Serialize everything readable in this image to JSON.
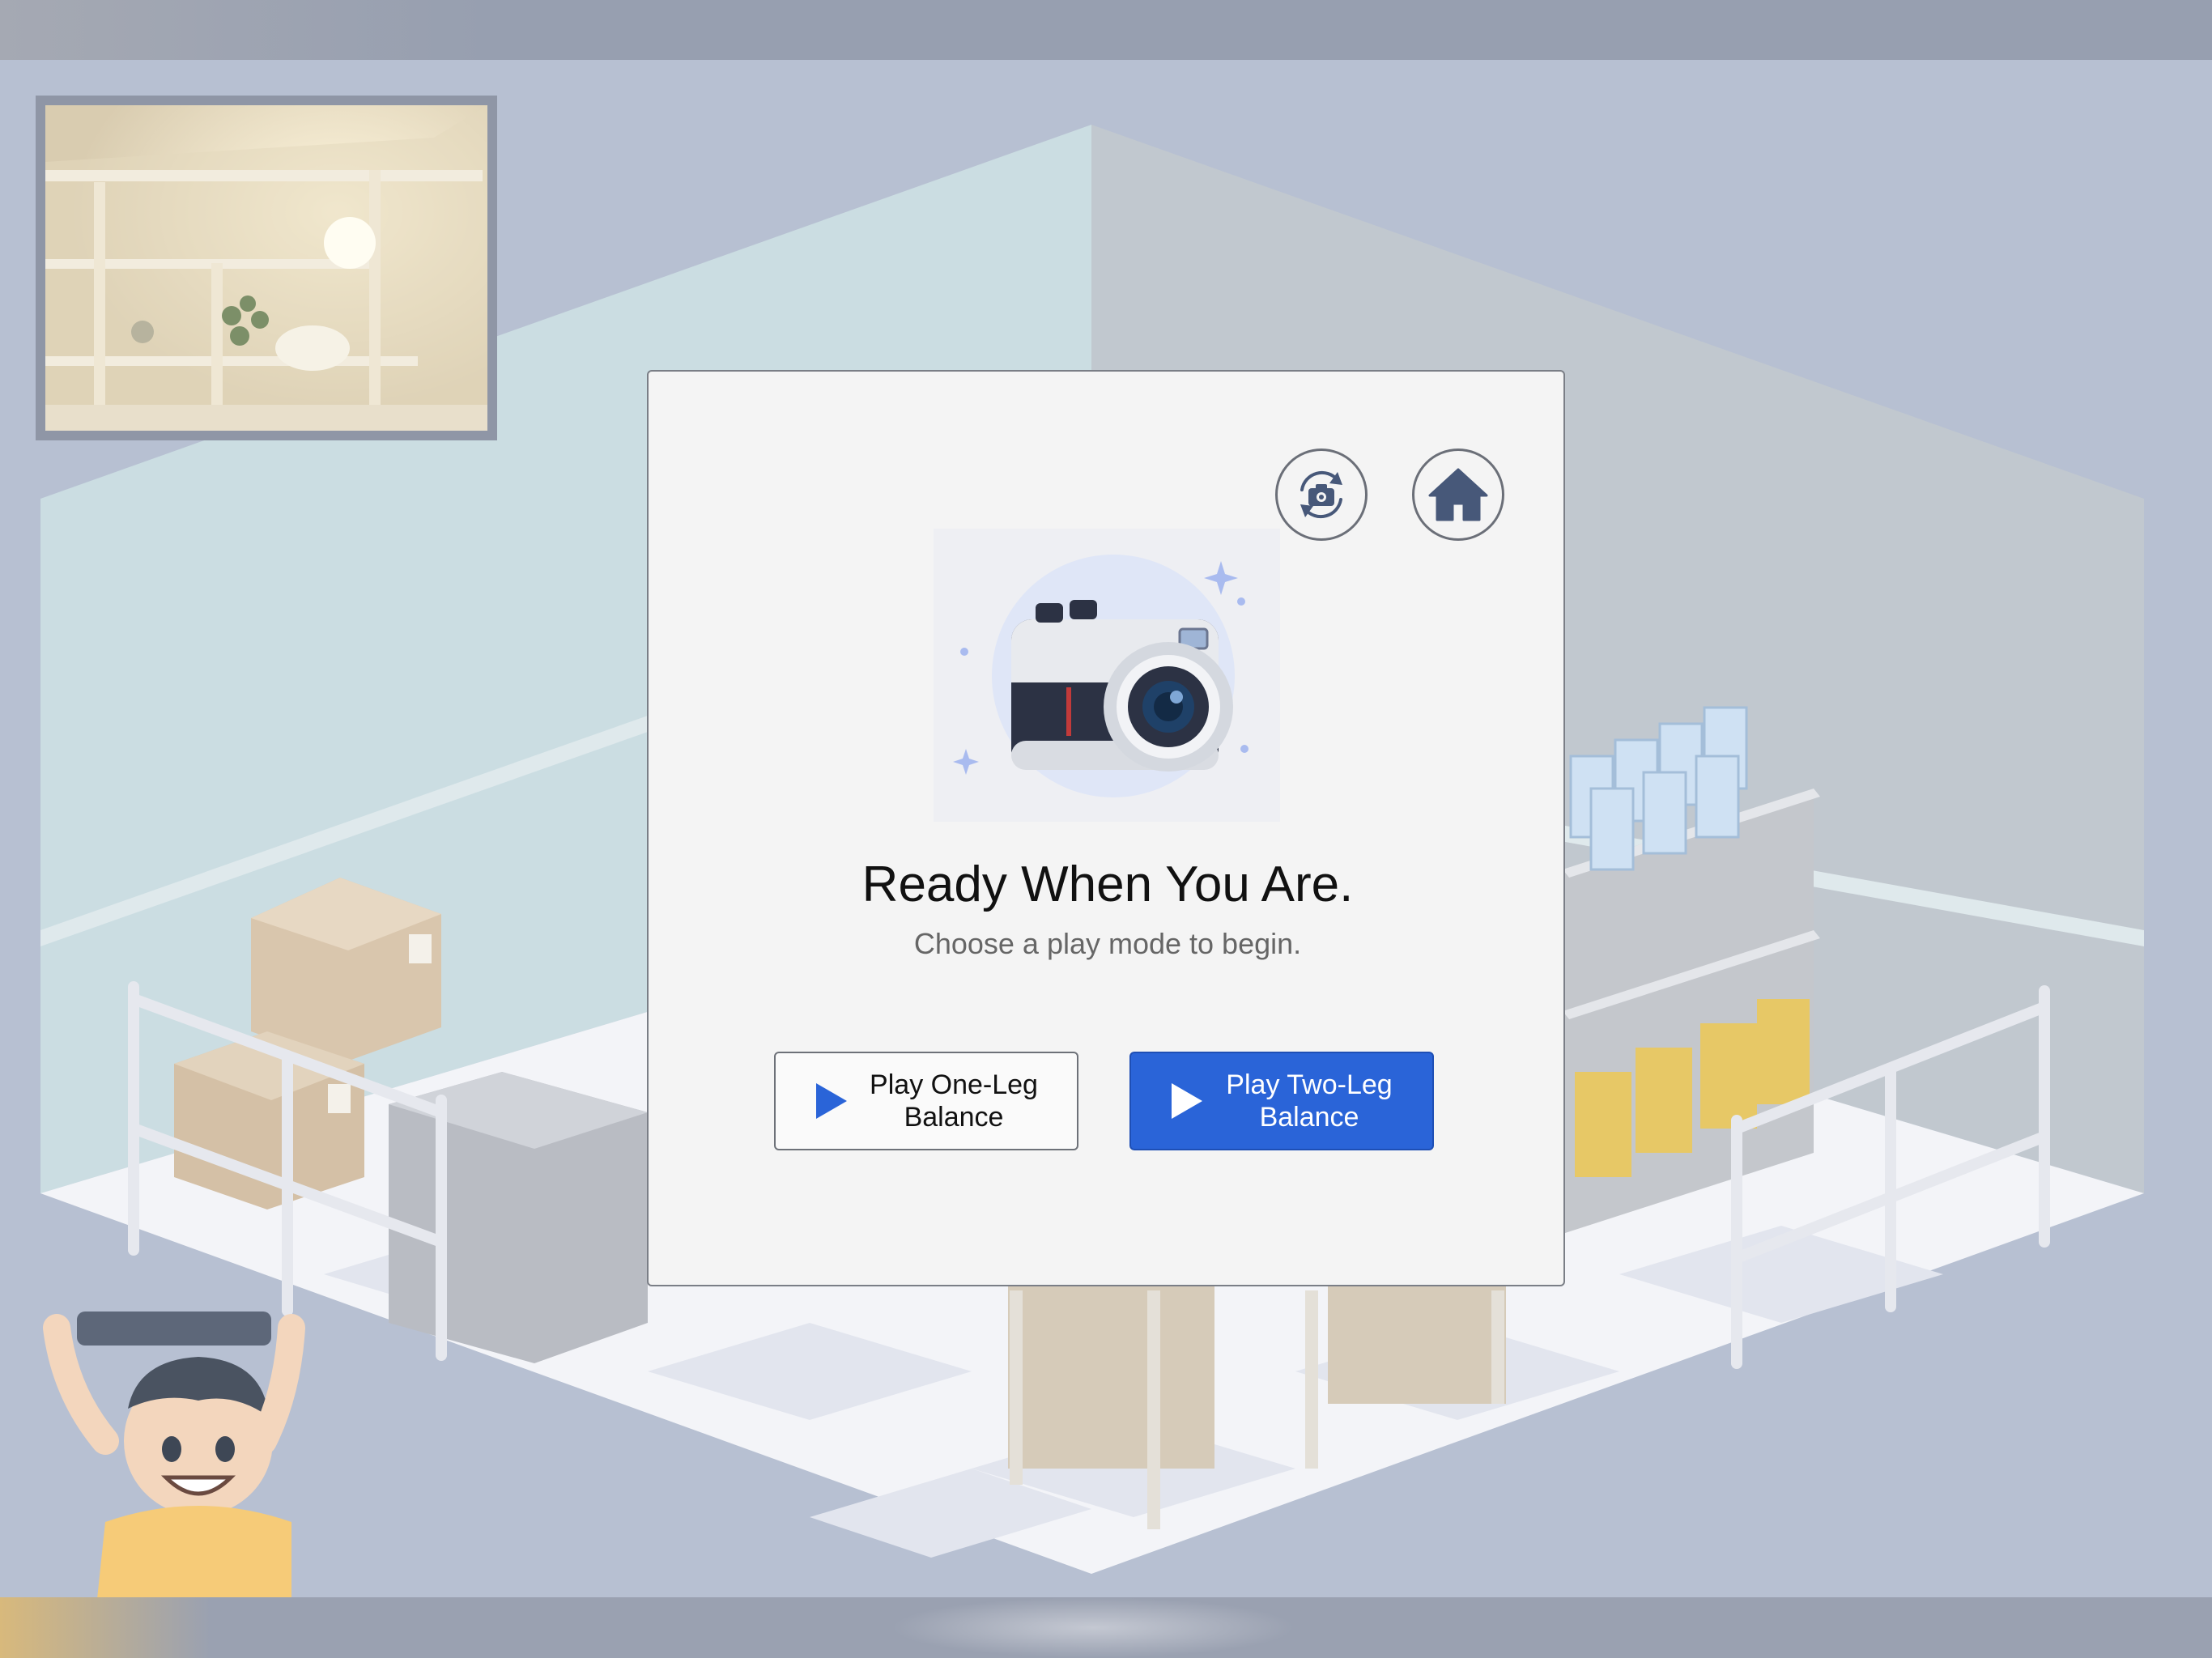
{
  "dialog": {
    "title": "Ready When You Are.",
    "subtitle": "Choose a play mode to begin.",
    "buttons": {
      "one_leg": "Play One-Leg\nBalance",
      "two_leg": "Play Two-Leg\nBalance"
    },
    "icons": {
      "switch_camera": "camera-switch-icon",
      "home": "home-icon",
      "hero": "camera-illustration",
      "play": "play-icon"
    }
  },
  "colors": {
    "primary_button": "#2a64d8",
    "icon": "#475879",
    "backdrop": "#b7c0d2"
  }
}
